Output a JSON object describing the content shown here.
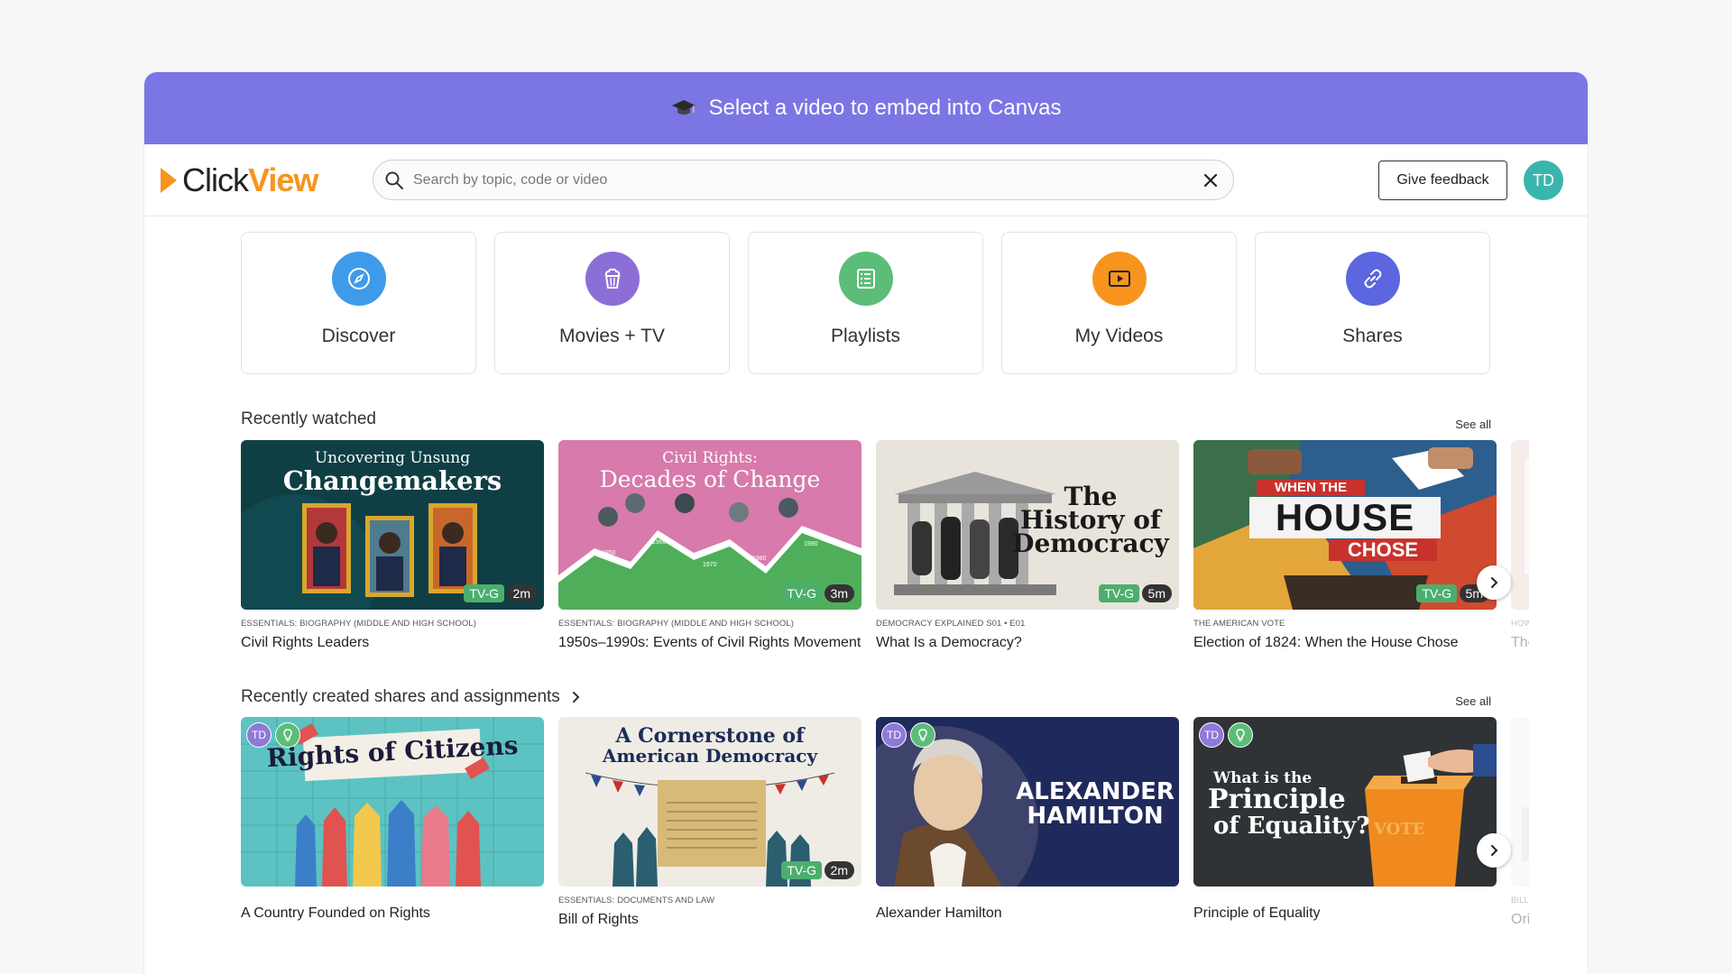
{
  "banner": {
    "text": "Select a video to embed into Canvas"
  },
  "header": {
    "logo_click": "Click",
    "logo_view": "View",
    "search_placeholder": "Search by topic, code or video",
    "feedback_label": "Give feedback",
    "avatar_initials": "TD"
  },
  "nav": [
    {
      "label": "Discover",
      "color": "#3d9be9",
      "icon": "compass-icon"
    },
    {
      "label": "Movies + TV",
      "color": "#8b6fd6",
      "icon": "popcorn-icon"
    },
    {
      "label": "Playlists",
      "color": "#5bbd78",
      "icon": "list-icon"
    },
    {
      "label": "My Videos",
      "color": "#f7941d",
      "icon": "play-box-icon"
    },
    {
      "label": "Shares",
      "color": "#5b66e0",
      "icon": "link-icon"
    }
  ],
  "recently_watched": {
    "title": "Recently watched",
    "see_all": "See all",
    "cards": [
      {
        "series": "Essentials: Biography (Middle and High School)",
        "title": "Civil Rights Leaders",
        "rating": "TV-G",
        "duration": "2m",
        "thumb_line1": "Uncovering Unsung",
        "thumb_line2": "Changemakers"
      },
      {
        "series": "Essentials: Biography (Middle and High School)",
        "title": "1950s–1990s: Events of Civil Rights Movement",
        "rating": "TV-G",
        "duration": "3m",
        "thumb_line1": "Civil Rights:",
        "thumb_line2": "Decades of Change",
        "years": [
          "1950",
          "1960",
          "1970",
          "1980",
          "1990"
        ]
      },
      {
        "series": "Democracy Explained S01 • E01",
        "title": "What Is a Democracy?",
        "rating": "TV-G",
        "duration": "5m",
        "thumb_line1": "The",
        "thumb_line2": "History of",
        "thumb_line3": "Democracy"
      },
      {
        "series": "The American Vote",
        "title": "Election of 1824: When the House Chose",
        "rating": "TV-G",
        "duration": "5m",
        "thumb_line1": "WHEN THE",
        "thumb_line2": "HOUSE",
        "thumb_line3": "CHOSE"
      },
      {
        "series": "How W",
        "title": "The "
      }
    ]
  },
  "recently_created": {
    "title": "Recently created shares and assignments",
    "see_all": "See all",
    "owner_initials": "TD",
    "cards": [
      {
        "title": "A Country Founded on Rights",
        "thumb_line1": "Rights of Citizens"
      },
      {
        "series": "Essentials: Documents and Law",
        "title": "Bill of Rights",
        "rating": "TV-G",
        "duration": "2m",
        "thumb_line1": "A Cornerstone of",
        "thumb_line2": "American Democracy"
      },
      {
        "title": "Alexander Hamilton",
        "thumb_line1": "ALEXANDER",
        "thumb_line2": "HAMILTON"
      },
      {
        "title": "Principle of Equality",
        "thumb_line1": "What is the",
        "thumb_line2": "Principle",
        "thumb_line3": "of Equality?",
        "thumb_line4": "VOTE"
      },
      {
        "series": "Bill o",
        "title": "Orig"
      }
    ]
  },
  "colors": {
    "banner": "#7b76e4",
    "accent": "#f7941d",
    "rating_green": "#4cae6e"
  }
}
